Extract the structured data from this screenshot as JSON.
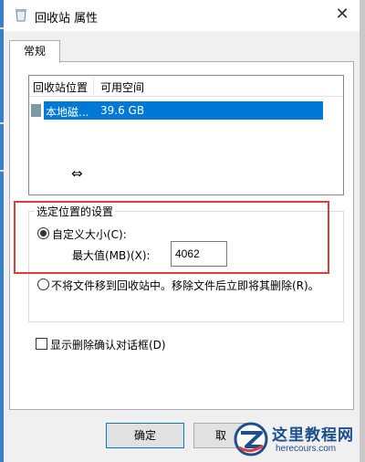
{
  "window": {
    "title": "回收站 属性",
    "close_glyph": "✕"
  },
  "tabs": [
    {
      "label": "常规",
      "active": true
    }
  ],
  "listview": {
    "columns": [
      "回收站位置",
      "可用空间"
    ],
    "rows": [
      {
        "location": "本地磁...",
        "free_space": "39.6 GB",
        "selected": true
      }
    ],
    "cursor_icon": "horizontal-resize-cursor"
  },
  "settings_group": {
    "label": "选定位置的设置",
    "custom_size": {
      "label": "自定义大小(C):",
      "checked": true
    },
    "max_value": {
      "label": "最大值(MB)(X):",
      "value": "4062"
    },
    "no_move": {
      "label": "不将文件移到回收站中。移除文件后立即将其删除(R)。",
      "checked": false
    }
  },
  "confirm_dialog": {
    "label": "显示删除确认对话框(D)",
    "checked": false
  },
  "buttons": {
    "ok": "确定",
    "cancel": "取"
  },
  "watermark": {
    "title": "这里教程网",
    "url": "herecours.com"
  },
  "colors": {
    "selection": "#0078d7",
    "highlight_box": "#e23b3b",
    "watermark_text": "#1d4f8f"
  }
}
